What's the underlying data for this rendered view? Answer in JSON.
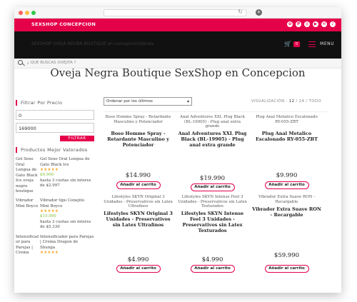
{
  "browser": {
    "reload_glyph": "↻",
    "newtab_glyph": "+"
  },
  "topbar": {
    "brand": "SEXSHOP CONCEPCION",
    "social_icons": [
      "pinterest-icon",
      "p-icon",
      "instagram-icon",
      "youtube-icon",
      "email-icon",
      "tiktok-icon"
    ],
    "social_glyphs": [
      "✿",
      "P",
      "◎",
      "▶",
      "✉",
      "♪"
    ]
  },
  "navbar": {
    "tagline": "SEXSHOP OVEJA NEGRA BOUTIQUE en concepción/tienda",
    "cart_glyph": "🛒",
    "cart_count": "0",
    "menu_label": "MENU"
  },
  "search": {
    "placeholder": "¿ QUE BUSCAS OVEJITA ?"
  },
  "page": {
    "title": "Oveja Negra Boutique SexShop en Concepcion"
  },
  "sidebar": {
    "price_filter_title": "Filtrar Por Precio",
    "min_price": "0",
    "max_price": "169000",
    "filter_button": "FILTRAR",
    "top_rated_title": "Productos Mejor Valorados",
    "items": [
      {
        "thumb_alt": "Gel Sexo Oral Lengua de Gato Black Ice oveja negra boutique en concepcion",
        "name": "Gel Sexo Oral Lengua de Gato Black Ice",
        "stars": "★★★★★",
        "price": "$9.990",
        "installments": "hasta 3 cuotas sin interes de $2.997"
      },
      {
        "thumb_alt": "Vibrador Mini Boyco",
        "name": "Vibrador tipo Conejito Mini Boyco",
        "stars": "★★★★★",
        "price": "$15.990",
        "installments": "hasta 3 cuotas sin interes de $5.330"
      },
      {
        "thumb_alt": "Intensificad or para Parejas | Crema Dragon de",
        "name": "Intensificador para Parejas | Crema Dragon de Shunga",
        "stars": "★★★★★",
        "price": "",
        "installments": ""
      }
    ]
  },
  "shop": {
    "sort_label": "Ordenar por los últimos",
    "view_label": "VISUALIZACIÓN :",
    "view_current": "12",
    "view_sep1": "/",
    "view_mid": "24",
    "view_sep2": "/",
    "view_all": "TODO",
    "add_to_cart": "Añadir al carrito",
    "products": [
      {
        "caption": "Boso Homme Spray - Retardante Masculino y Potenciador",
        "name": "Boso Homme Spray - Retardante Masculino y Potenciador",
        "price": "$14.990"
      },
      {
        "caption": "Anal Adventures XXL Plug Black (BL-19905) - Plug anal extra grande",
        "name": "Anal Adventures XXL Plug Black (BL-19905) - Plug anal extra grande",
        "price": "$19.990"
      },
      {
        "caption": "Plug Anal Metalico Escalonado RY-055-ZBT",
        "name": "Plug Anal Metalico Escalonado RY-055-ZBT",
        "price": "$9.990"
      },
      {
        "caption": "Lifestyles SKYN Original 3 Unidades - Preservativos sin Latex Ultrafinos",
        "name": "Lifestyles SKYN Original 3 Unidades - Preservativos sin Latex Ultrafinos",
        "price": "$4.990"
      },
      {
        "caption": "Lifestyles SKYN Intense Feel 3 Unidades - Preservativos sin Latex Texturados",
        "name": "Lifestyles SKYN Intense Feel 3 Unidades - Preservativos sin Latex Texturados",
        "price": "$4.990"
      },
      {
        "caption": "Vibrador Extra Suave RON - Recargable",
        "name": "Vibrador Extra Suave RON - Recargable",
        "price": "$59.990"
      }
    ]
  },
  "colors": {
    "accent": "#e5004a",
    "nav_bg": "#111111",
    "star": "#f5a623",
    "price_green": "#7dbb2c"
  }
}
